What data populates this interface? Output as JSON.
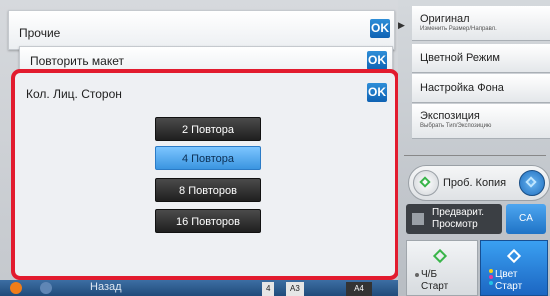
{
  "panels": {
    "misc": {
      "label": "Прочие",
      "ok": "OK"
    },
    "repeat": {
      "label": "Повторить макет",
      "ok": "OK"
    },
    "sides": {
      "label": "Кол. Лиц. Сторон",
      "ok": "OK"
    }
  },
  "options": [
    {
      "label": "2 Повтора",
      "selected": false
    },
    {
      "label": "4 Повтора",
      "selected": true
    },
    {
      "label": "8 Повторов",
      "selected": false
    },
    {
      "label": "16 Повторов",
      "selected": false
    }
  ],
  "bottom": {
    "back": "Назад",
    "paper_a": "4",
    "paper_b": "A3",
    "paper_c": "A4"
  },
  "right_menu": {
    "original": {
      "title": "Оригинал",
      "sub": "Изменить Размер/Направл."
    },
    "color_mode": {
      "title": "Цветной Режим"
    },
    "background": {
      "title": "Настройка Фона"
    },
    "exposure": {
      "title": "Экспозиция",
      "sub": "Выбрать Тип/Экспозицию"
    }
  },
  "proof_copy": "Проб. Копия",
  "preview": {
    "line1": "Предварит.",
    "line2": "Просмотр"
  },
  "ca": "CA",
  "start_bw": {
    "line1": "Ч/Б",
    "line2": "Старт"
  },
  "start_color": {
    "line1": "Цвет",
    "line2": "Старт"
  },
  "colors": {
    "accent_blue": "#1f73c6",
    "highlight_red": "#e21b2e",
    "selected_option": "#5aaef0"
  }
}
